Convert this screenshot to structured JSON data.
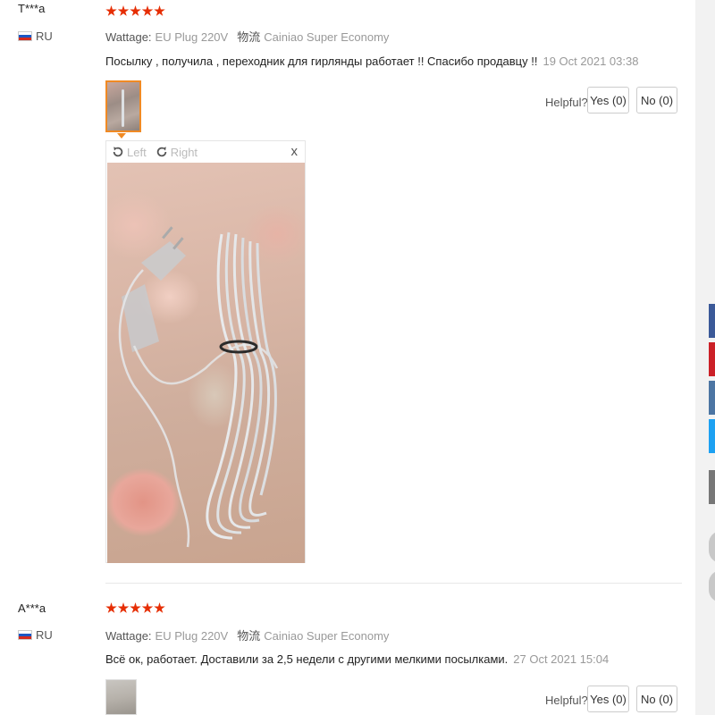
{
  "reviews": [
    {
      "user": "T***a",
      "country": "RU",
      "stars": 5,
      "wattage_label": "Wattage:",
      "wattage_value": "EU Plug 220V",
      "shipping_label": "物流",
      "shipping_value": "Cainiao Super Economy",
      "text": "Посылку , получила , переходник для гирлянды работает !! Спасибо продавцу !!",
      "date": "19 Oct 2021 03:38",
      "helpful_label": "Helpful?",
      "yes_label": "Yes (0)",
      "no_label": "No (0)"
    },
    {
      "user": "A***a",
      "country": "RU",
      "stars": 5,
      "wattage_label": "Wattage:",
      "wattage_value": "EU Plug 220V",
      "shipping_label": "物流",
      "shipping_value": "Cainiao Super Economy",
      "text": "Всё ок, работает. Доставили за 2,5 недели с другими мелкими посылками.",
      "date": "27 Oct 2021 15:04",
      "helpful_label": "Helpful?",
      "yes_label": "Yes (0)",
      "no_label": "No (0)"
    }
  ],
  "viewer": {
    "rotate_left_label": "Left",
    "rotate_right_label": "Right",
    "close_label": "x"
  },
  "colors": {
    "star": "#e62e04",
    "thumb_active": "#f08a24",
    "share_facebook": "#3b5998",
    "share_pinterest": "#cb2027",
    "share_vk": "#4c75a3",
    "share_twitter": "#1da1f2",
    "share_more": "#777777"
  },
  "icons": [
    "flag-ru-icon",
    "star-icon",
    "rotate-left-icon",
    "rotate-right-icon",
    "close-icon"
  ]
}
